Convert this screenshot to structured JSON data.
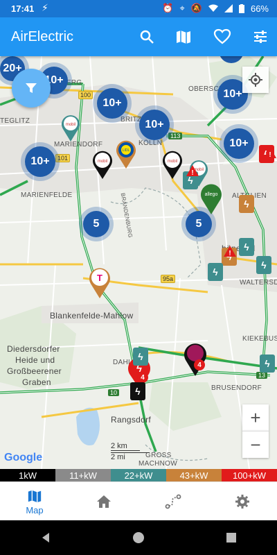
{
  "status_bar": {
    "time": "17:41",
    "battery": "66%",
    "icons": [
      "lightning-icon",
      "alarm-icon",
      "location-icon",
      "mute-icon",
      "wifi-icon",
      "signal-icon",
      "battery-icon"
    ]
  },
  "app_bar": {
    "title": "AirElectric",
    "actions": [
      "search-icon",
      "map-icon",
      "favorite-icon",
      "tune-icon"
    ]
  },
  "map": {
    "clusters": [
      "20+",
      "10+",
      "10+",
      "10+",
      "10+",
      "10+",
      "10+",
      "5",
      "5"
    ],
    "place_labels": [
      "TEGLITZ",
      "MARIENDORF",
      "MARIENFELDE",
      "BRITZ",
      "KÖLLN",
      "OBERSCH",
      "ALTGLIEN",
      "Blankenfelde-Mahlow",
      "Diedersdorfer",
      "Heide und",
      "Großbeerener",
      "Graben",
      "Rangsdorf",
      "DAHL",
      "BRUSENDORF",
      "KIEKEBUSC",
      "WALTERSDO",
      "BRANDENBURG",
      "hönefeld",
      "GROSS",
      "MACHNOW",
      "EBERG"
    ],
    "road_shields": [
      "100",
      "113",
      "101",
      "95a",
      "10",
      "13"
    ],
    "pin_badges": [
      "4",
      "4"
    ],
    "scale": {
      "km": "2 km",
      "mi": "2 mi"
    },
    "attribution": "Google",
    "zoom_in": "+",
    "zoom_out": "−"
  },
  "legend": [
    {
      "label": "1kW",
      "color": "#000000"
    },
    {
      "label": "11+kW",
      "color": "#8a8a8a"
    },
    {
      "label": "22+kW",
      "color": "#3f8e8e"
    },
    {
      "label": "43+kW",
      "color": "#c8823a"
    },
    {
      "label": "100+kW",
      "color": "#e11b1b"
    }
  ],
  "bottom_nav": [
    {
      "label": "Map",
      "icon": "map-icon",
      "active": true
    },
    {
      "label": "",
      "icon": "home-icon",
      "active": false
    },
    {
      "label": "",
      "icon": "route-icon",
      "active": false
    },
    {
      "label": "",
      "icon": "settings-icon",
      "active": false
    }
  ]
}
